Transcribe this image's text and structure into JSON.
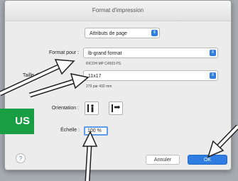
{
  "window": {
    "title": "Format d'impression"
  },
  "attributes_select": {
    "value": "Attributs de page"
  },
  "format_for": {
    "label": "Format pour :",
    "value": "lb-grand format",
    "printer": "RICOH MP C4503 PS"
  },
  "paper_size": {
    "label": "Taille du",
    "value": "11x17",
    "dimensions": "279 par 432 mm"
  },
  "orientation": {
    "label": "Orientation :"
  },
  "scale": {
    "label": "Échelle :",
    "value": "100 %"
  },
  "buttons": {
    "help": "?",
    "cancel": "Annuler",
    "ok": "OK"
  },
  "overlay": {
    "badge": "US"
  },
  "colors": {
    "accent": "#2f7de1",
    "badge": "#1a9e43"
  }
}
